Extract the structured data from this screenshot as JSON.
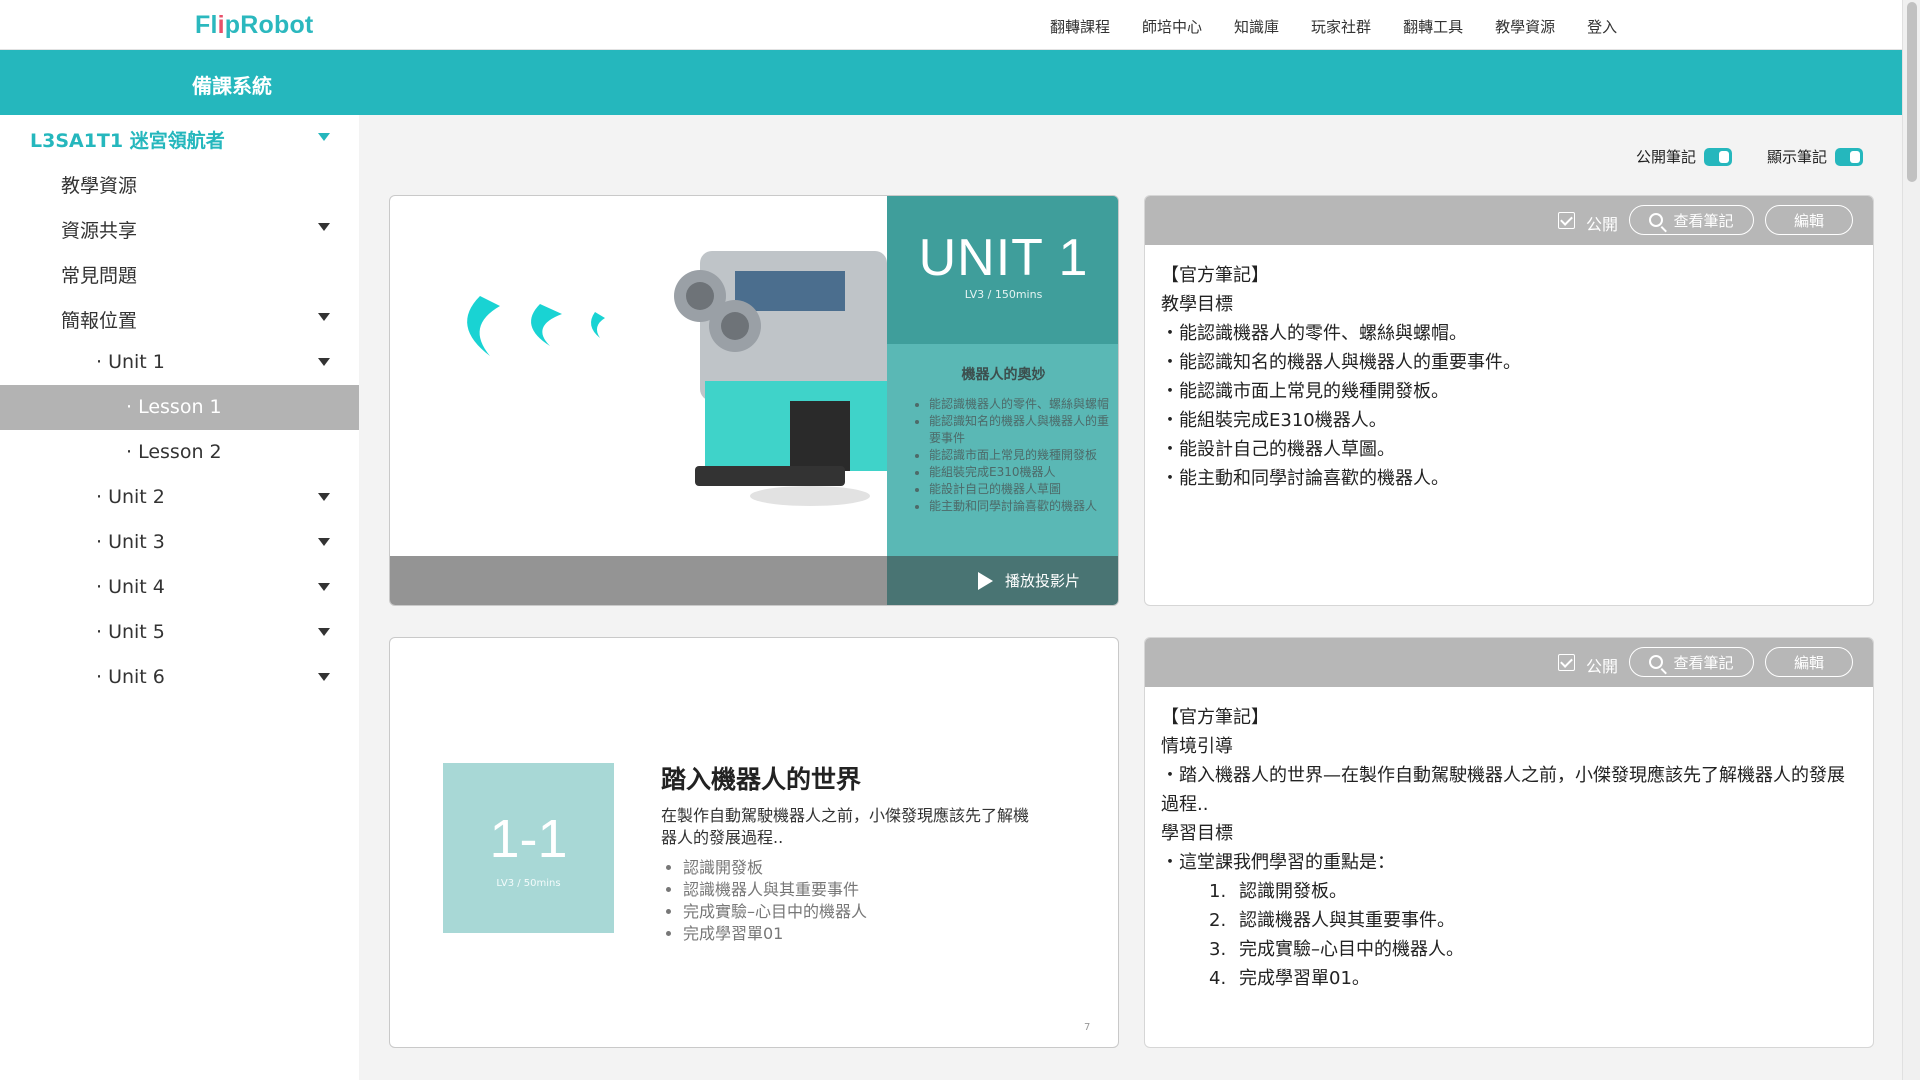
{
  "brand": {
    "logo_part1": "Fl",
    "logo_part2": "i",
    "logo_part3": "pRobot"
  },
  "nav": {
    "items": [
      "翻轉課程",
      "師培中心",
      "知識庫",
      "玩家社群",
      "翻轉工具",
      "教學資源",
      "登入"
    ]
  },
  "banner": {
    "title": "備課系統"
  },
  "sidebar": {
    "items": [
      {
        "label": "L3SA1T1 迷宮領航者"
      },
      {
        "label": "教學資源"
      },
      {
        "label": "資源共享"
      },
      {
        "label": "常見問題"
      },
      {
        "label": "簡報位置"
      },
      {
        "label": "· Unit 1"
      },
      {
        "label": "· Lesson 1"
      },
      {
        "label": "· Lesson 2"
      },
      {
        "label": "· Unit 2"
      },
      {
        "label": "· Unit 3"
      },
      {
        "label": "· Unit 4"
      },
      {
        "label": "· Unit 5"
      },
      {
        "label": "· Unit 6"
      }
    ]
  },
  "toggles": {
    "public_label": "公開筆記",
    "show_label": "顯示筆記",
    "public_on": true,
    "show_on": true
  },
  "note_toolbar": {
    "public": "公開",
    "view": "查看筆記",
    "edit": "編輯"
  },
  "slide1": {
    "unit": "UNIT 1",
    "level": "LV3 / 150mins",
    "subtitle": "機器人的奧妙",
    "bullets": [
      "能認識機器人的零件、螺絲與螺帽",
      "能認識知名的機器人與機器人的重要事件",
      "能認識市面上常見的幾種開發板",
      "能組裝完成E310機器人",
      "能設計自己的機器人草圖",
      "能主動和同學討論喜歡的機器人"
    ],
    "play_label": "播放投影片"
  },
  "note1": {
    "lines": [
      "【官方筆記】",
      "教學目標",
      "・能認識機器人的零件、螺絲與螺帽。",
      "・能認識知名的機器人與機器人的重要事件。",
      "・能認識市面上常見的幾種開發板。",
      "・能組裝完成E310機器人。",
      "・能設計自己的機器人草圖。",
      "・能主動和同學討論喜歡的機器人。"
    ]
  },
  "slide2": {
    "num": "1-1",
    "level": "LV3 / 50mins",
    "title": "踏入機器人的世界",
    "desc": "在製作自動駕駛機器人之前，小傑發現應該先了解機器人的發展過程..",
    "bullets": [
      "認識開發板",
      "認識機器人與其重要事件",
      "完成實驗–心目中的機器人",
      "完成學習單01"
    ],
    "page": "7"
  },
  "note2": {
    "lines": [
      "【官方筆記】",
      "情境引導",
      "・踏入機器人的世界—在製作自動駕駛機器人之前，小傑發現應該先了解機器人的發展過程..",
      "學習目標",
      "・這堂課我們學習的重點是："
    ],
    "ordered": [
      {
        "num": "1.",
        "text": "認識開發板。"
      },
      {
        "num": "2.",
        "text": "認識機器人與其重要事件。"
      },
      {
        "num": "3.",
        "text": "完成實驗–心目中的機器人。"
      },
      {
        "num": "4.",
        "text": "完成學習單01。"
      }
    ]
  },
  "colors": {
    "accent": "#25b7bd",
    "note_header": "#b7b7b7",
    "active_row": "#b3b3b3"
  }
}
